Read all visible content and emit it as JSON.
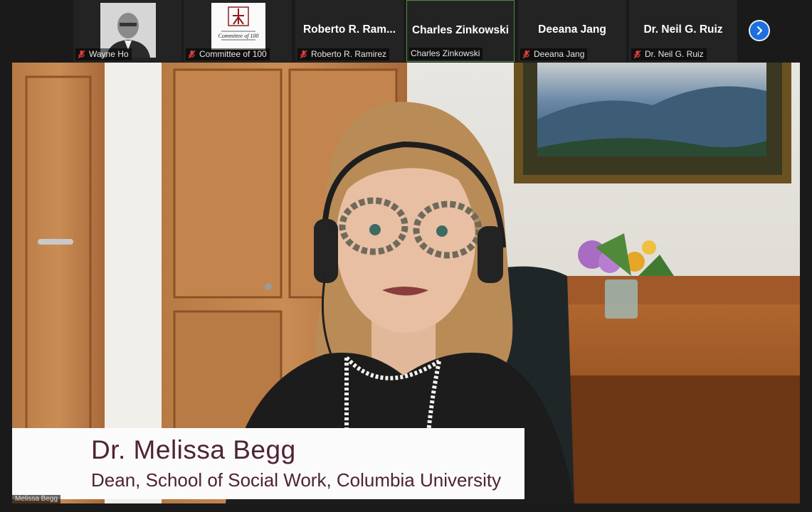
{
  "participants": [
    {
      "display": "",
      "tag": "Wayne Ho",
      "muted": true,
      "kind": "photo"
    },
    {
      "display": "",
      "tag": "Committee of 100",
      "muted": true,
      "kind": "logo",
      "logo_text": "Committee of 100"
    },
    {
      "display": "Roberto R. Ram...",
      "tag": "Roberto R. Ramirez",
      "muted": true,
      "kind": "name"
    },
    {
      "display": "Charles Zinkowski",
      "tag": "Charles Zinkowski",
      "muted": false,
      "kind": "name",
      "active": true
    },
    {
      "display": "Deeana Jang",
      "tag": "Deeana Jang",
      "muted": true,
      "kind": "name"
    },
    {
      "display": "Dr. Neil G. Ruiz",
      "tag": "Dr. Neil G. Ruiz",
      "muted": true,
      "kind": "name"
    }
  ],
  "speaker": {
    "name": "Dr. Melissa Begg",
    "title": "Dean, School of Social Work, Columbia University",
    "tag": "Melissa Begg"
  },
  "colors": {
    "mute_red": "#e0403a",
    "next_button": "#1d6fe0",
    "lower_third_text": "#4e2336"
  }
}
